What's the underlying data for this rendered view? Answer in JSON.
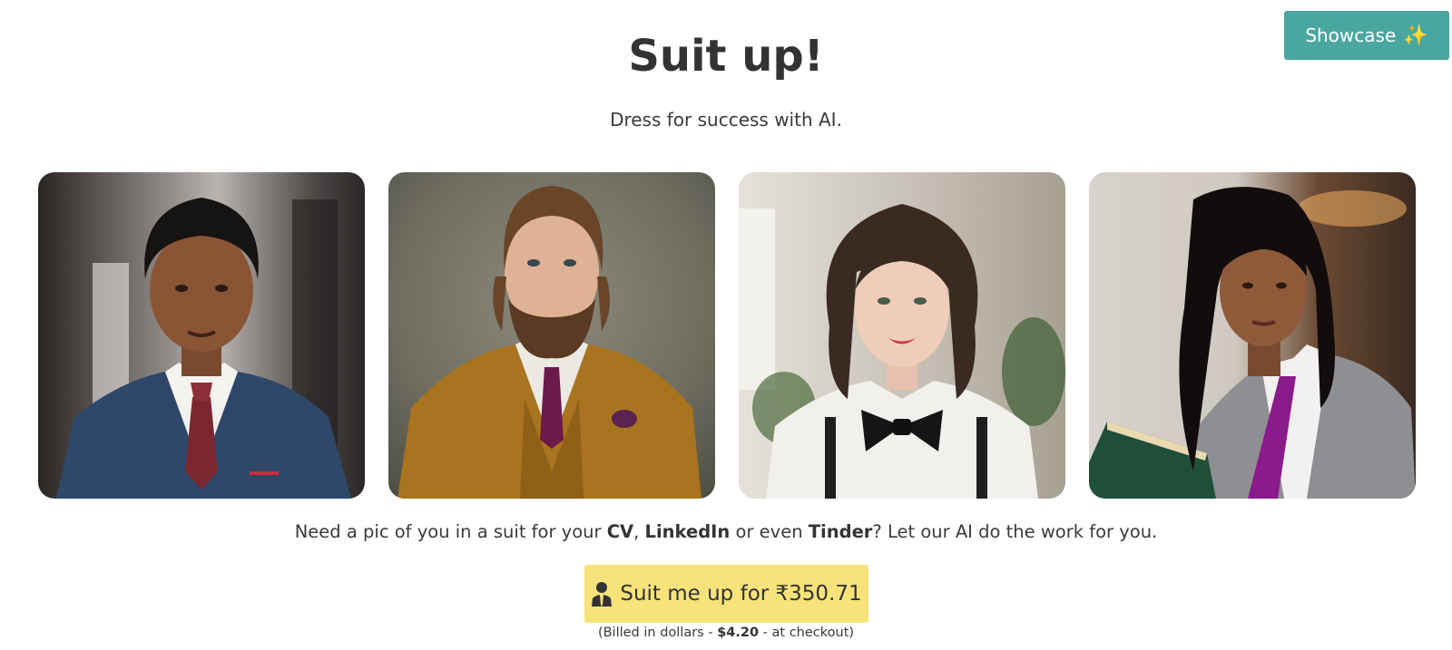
{
  "header": {
    "showcase_label": "Showcase",
    "showcase_icon": "sparkles-icon"
  },
  "hero": {
    "title": "Suit up!",
    "subtitle": "Dress for success with AI."
  },
  "gallery": {
    "items": [
      {
        "name": "portrait-man-navy-suit"
      },
      {
        "name": "portrait-man-mustard-suit"
      },
      {
        "name": "portrait-woman-bowtie"
      },
      {
        "name": "portrait-woman-grey-blazer"
      }
    ]
  },
  "description": {
    "part1": "Need a pic of you in a suit for your ",
    "cv": "CV",
    "sep1": ", ",
    "linkedin": "LinkedIn",
    "part2": " or even ",
    "tinder": "Tinder",
    "part3": "? Let our AI do the work for you."
  },
  "cta": {
    "icon": "person-suit-icon",
    "label": "Suit me up for ₹350.71"
  },
  "billing": {
    "prefix": "(Billed in dollars - ",
    "amount": "$4.20",
    "suffix": " - at checkout)"
  },
  "colors": {
    "showcase_bg": "#4aa7a0",
    "cta_bg": "#f7e37a",
    "text": "#333333"
  }
}
